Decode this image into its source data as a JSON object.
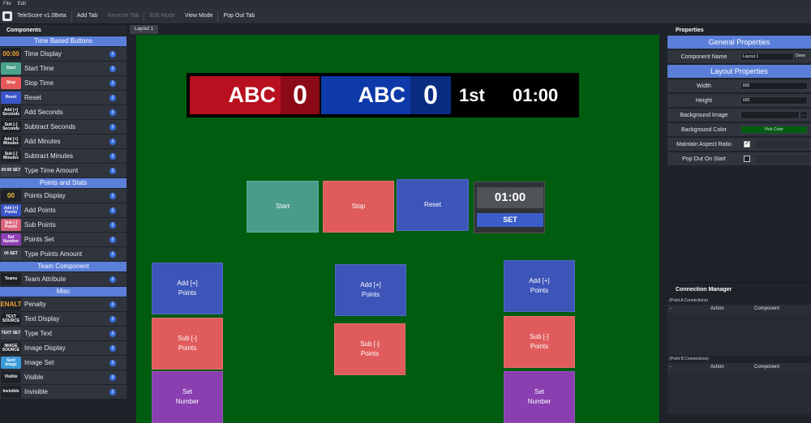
{
  "menubar": {
    "items": [
      "File",
      "Edit"
    ]
  },
  "toolbar": {
    "app_title": "TeleScore v1.0Beta",
    "add_tab": "Add Tab",
    "remove_tab": "Remove Tab",
    "edit_mode": "Edit Mode",
    "view_mode": "View Mode",
    "pop_out_tab": "Pop Out Tab"
  },
  "components": {
    "title": "Components",
    "sections": [
      {
        "label": "Time Based Buttons",
        "items": [
          {
            "icon_text": "00:00",
            "icon_color": "#1f2227",
            "icon_text_color": "#f4a334",
            "label": "Time Display"
          },
          {
            "icon_text": "Start",
            "icon_color": "#4aa38a",
            "label": "Start Time"
          },
          {
            "icon_text": "Stop",
            "icon_color": "#e85a5a",
            "label": "Stop Time"
          },
          {
            "icon_text": "Reset",
            "icon_color": "#3a55c7",
            "label": "Reset"
          },
          {
            "icon_text": "Add [+] Seconds",
            "icon_color": "#1f2227",
            "label": "Add Seconds"
          },
          {
            "icon_text": "Sub [-] Seconds",
            "icon_color": "#1f2227",
            "label": "Subtract Seconds"
          },
          {
            "icon_text": "Add [+] Minutes",
            "icon_color": "#1f2227",
            "label": "Add Minutes"
          },
          {
            "icon_text": "Sub [-] Minutes",
            "icon_color": "#1f2227",
            "label": "Subtract Minutes"
          },
          {
            "icon_text": "00:00 SET",
            "icon_color": "#3a3f48",
            "label": "Type Time Amount"
          }
        ]
      },
      {
        "label": "Points and Stats",
        "items": [
          {
            "icon_text": "00",
            "icon_color": "#1f2227",
            "icon_text_color": "#f4c534",
            "label": "Points Display"
          },
          {
            "icon_text": "Add [+] Points",
            "icon_color": "#3a55c7",
            "label": "Add Points"
          },
          {
            "icon_text": "Sub [-] Points",
            "icon_color": "#d9607a",
            "label": "Sub Points"
          },
          {
            "icon_text": "Set Number",
            "icon_color": "#8e3fb5",
            "label": "Points Set"
          },
          {
            "icon_text": "00 SET",
            "icon_color": "#3a3f48",
            "label": "Type Points Amount"
          }
        ]
      },
      {
        "label": "Team Component",
        "items": [
          {
            "icon_text": "Teams",
            "icon_color": "#1f2227",
            "label": "Team Attribute"
          }
        ]
      },
      {
        "label": "Misc",
        "items": [
          {
            "icon_text": "PENALTY",
            "icon_color": "#1f2227",
            "icon_text_color": "#f4a334",
            "label": "Penalty"
          },
          {
            "icon_text": "TEXT SOURCE",
            "icon_color": "#1f2227",
            "label": "Text Display"
          },
          {
            "icon_text": "TEXT SET",
            "icon_color": "#3a3f48",
            "label": "Type Text"
          },
          {
            "icon_text": "IMAGE SOURCE",
            "icon_color": "#1f2227",
            "label": "Image Display"
          },
          {
            "icon_text": "Sent Image",
            "icon_color": "#3a9ad9",
            "label": "Image Set"
          },
          {
            "icon_text": "Visible",
            "icon_color": "#1f2227",
            "label": "Visible"
          },
          {
            "icon_text": "Invisible",
            "icon_color": "#1f2227",
            "label": "Invisible"
          }
        ]
      }
    ]
  },
  "tabs": [
    {
      "label": "Layout 1"
    }
  ],
  "canvas": {
    "background": "#005c0f",
    "scoreboard": {
      "home_name": "ABC",
      "home_score": "0",
      "home_color": "#b8101f",
      "home_score_color": "#8c0a17",
      "away_name": "ABC",
      "away_score": "0",
      "away_color": "#0d3aa8",
      "away_score_color": "#0a2c80",
      "period": "1st",
      "clock": "01:00"
    },
    "controls": {
      "start": "Start",
      "stop": "Stop",
      "reset": "Reset",
      "time": "01:00",
      "set": "SET"
    },
    "columns": [
      {
        "add": "Add [+]\nPoints",
        "sub": "Sub [-]\nPoints",
        "set": "Set\nNumber"
      },
      {
        "add": "Add [+]\nPoints",
        "sub": "Sub [-]\nPoints"
      },
      {
        "add": "Add [+]\nPoints",
        "sub": "Sub [-]\nPoints",
        "set": "Set\nNumber"
      }
    ],
    "colors": {
      "start": "#4a9c8a",
      "stop": "#e05c5c",
      "reset": "#3d55b8",
      "add": "#3d55b8",
      "sub": "#e05c5c",
      "set": "#8a3fb0"
    }
  },
  "properties": {
    "title": "Properties",
    "general_header": "General Properties",
    "component_name_label": "Component Name",
    "component_name_value": "Layout 1",
    "done_label": "Done",
    "layout_header": "Layout Properties",
    "width_label": "Width",
    "width_value": "800",
    "height_label": "Height",
    "height_value": "600",
    "bg_image_label": "Background Image",
    "bg_image_button": "...",
    "bg_color_label": "Background Color",
    "bg_color_button": "Pick Color",
    "bg_color_swatch": "#005c0f",
    "aspect_label": "Maintain Aspect Ratio",
    "aspect_checked": true,
    "popout_label": "Pop Out On Start",
    "popout_checked": false
  },
  "connections": {
    "title": "Connection Manager",
    "a_label": "(Point A Connections)",
    "b_label": "(Point B Connections)",
    "col_dash": "-",
    "col_action": "Action",
    "col_component": "Component"
  }
}
